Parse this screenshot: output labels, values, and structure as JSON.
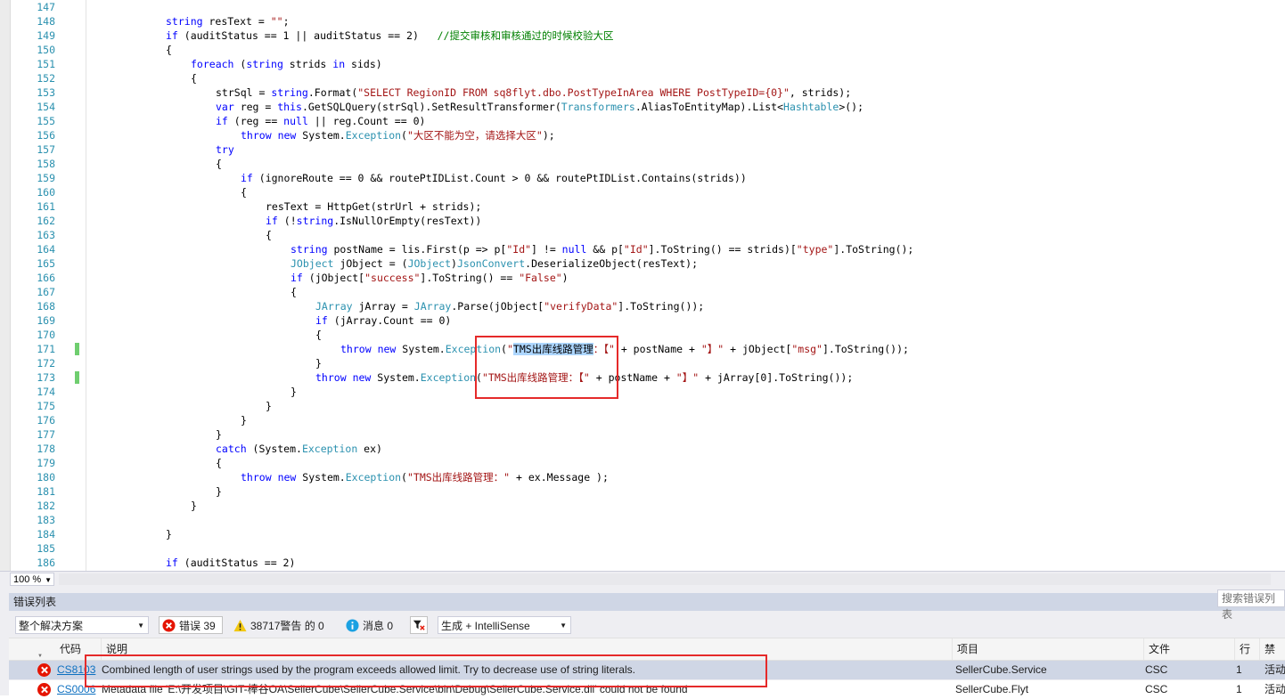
{
  "editor": {
    "lines": [
      {
        "num": "147",
        "indent": 0,
        "segs": []
      },
      {
        "num": "148",
        "indent": 2,
        "segs": [
          [
            "kw",
            "string"
          ],
          [
            "p",
            " resText = "
          ],
          [
            "str",
            "\"\""
          ],
          [
            "p",
            ";"
          ]
        ]
      },
      {
        "num": "149",
        "indent": 2,
        "segs": [
          [
            "kw",
            "if"
          ],
          [
            "p",
            " (auditStatus == 1 || auditStatus == 2)   "
          ],
          [
            "cm",
            "//提交审核和审核通过的时候校验大区"
          ]
        ]
      },
      {
        "num": "150",
        "indent": 2,
        "segs": [
          [
            "p",
            "{"
          ]
        ]
      },
      {
        "num": "151",
        "indent": 3,
        "segs": [
          [
            "kw",
            "foreach"
          ],
          [
            "p",
            " ("
          ],
          [
            "kw",
            "string"
          ],
          [
            "p",
            " strids "
          ],
          [
            "kw",
            "in"
          ],
          [
            "p",
            " sids)"
          ]
        ]
      },
      {
        "num": "152",
        "indent": 3,
        "segs": [
          [
            "p",
            "{"
          ]
        ]
      },
      {
        "num": "153",
        "indent": 4,
        "segs": [
          [
            "p",
            "strSql = "
          ],
          [
            "kw",
            "string"
          ],
          [
            "p",
            ".Format("
          ],
          [
            "str",
            "\"SELECT RegionID FROM sq8flyt.dbo.PostTypeInArea WHERE PostTypeID={0}\""
          ],
          [
            "p",
            ", strids);"
          ]
        ]
      },
      {
        "num": "154",
        "indent": 4,
        "segs": [
          [
            "kw",
            "var"
          ],
          [
            "p",
            " reg = "
          ],
          [
            "kw",
            "this"
          ],
          [
            "p",
            ".GetSQLQuery(strSql).SetResultTransformer("
          ],
          [
            "ty",
            "Transformers"
          ],
          [
            "p",
            ".AliasToEntityMap).List<"
          ],
          [
            "ty",
            "Hashtable"
          ],
          [
            "p",
            ">();"
          ]
        ]
      },
      {
        "num": "155",
        "indent": 4,
        "segs": [
          [
            "kw",
            "if"
          ],
          [
            "p",
            " (reg == "
          ],
          [
            "kw",
            "null"
          ],
          [
            "p",
            " || reg.Count == 0)"
          ]
        ]
      },
      {
        "num": "156",
        "indent": 5,
        "segs": [
          [
            "kw",
            "throw"
          ],
          [
            "p",
            " "
          ],
          [
            "kw",
            "new"
          ],
          [
            "p",
            " System."
          ],
          [
            "ty",
            "Exception"
          ],
          [
            "p",
            "("
          ],
          [
            "str",
            "\"大区不能为空，请选择大区\""
          ],
          [
            "p",
            ");"
          ]
        ]
      },
      {
        "num": "157",
        "indent": 4,
        "segs": [
          [
            "kw",
            "try"
          ]
        ]
      },
      {
        "num": "158",
        "indent": 4,
        "segs": [
          [
            "p",
            "{"
          ]
        ]
      },
      {
        "num": "159",
        "indent": 5,
        "segs": [
          [
            "kw",
            "if"
          ],
          [
            "p",
            " (ignoreRoute == 0 && routePtIDList.Count > 0 && routePtIDList.Contains(strids))"
          ]
        ]
      },
      {
        "num": "160",
        "indent": 5,
        "segs": [
          [
            "p",
            "{"
          ]
        ]
      },
      {
        "num": "161",
        "indent": 6,
        "segs": [
          [
            "p",
            "resText = HttpGet(strUrl + strids);"
          ]
        ]
      },
      {
        "num": "162",
        "indent": 6,
        "segs": [
          [
            "kw",
            "if"
          ],
          [
            "p",
            " (!"
          ],
          [
            "kw",
            "string"
          ],
          [
            "p",
            ".IsNullOrEmpty(resText))"
          ]
        ]
      },
      {
        "num": "163",
        "indent": 6,
        "segs": [
          [
            "p",
            "{"
          ]
        ]
      },
      {
        "num": "164",
        "indent": 7,
        "segs": [
          [
            "kw",
            "string"
          ],
          [
            "p",
            " postName = lis.First(p => p["
          ],
          [
            "str",
            "\"Id\""
          ],
          [
            "p",
            "] != "
          ],
          [
            "kw",
            "null"
          ],
          [
            "p",
            " && p["
          ],
          [
            "str",
            "\"Id\""
          ],
          [
            "p",
            "].ToString() == strids)["
          ],
          [
            "str",
            "\"type\""
          ],
          [
            "p",
            "].ToString();"
          ]
        ]
      },
      {
        "num": "165",
        "indent": 7,
        "segs": [
          [
            "ty",
            "JObject"
          ],
          [
            "p",
            " jObject = ("
          ],
          [
            "ty",
            "JObject"
          ],
          [
            "p",
            ")"
          ],
          [
            "ty",
            "JsonConvert"
          ],
          [
            "p",
            ".DeserializeObject(resText);"
          ]
        ]
      },
      {
        "num": "166",
        "indent": 7,
        "segs": [
          [
            "kw",
            "if"
          ],
          [
            "p",
            " (jObject["
          ],
          [
            "str",
            "\"success\""
          ],
          [
            "p",
            "].ToString() == "
          ],
          [
            "str",
            "\"False\""
          ],
          [
            "p",
            ")"
          ]
        ]
      },
      {
        "num": "167",
        "indent": 7,
        "segs": [
          [
            "p",
            "{"
          ]
        ]
      },
      {
        "num": "168",
        "indent": 8,
        "segs": [
          [
            "ty",
            "JArray"
          ],
          [
            "p",
            " jArray = "
          ],
          [
            "ty",
            "JArray"
          ],
          [
            "p",
            ".Parse(jObject["
          ],
          [
            "str",
            "\"verifyData\""
          ],
          [
            "p",
            "].ToString());"
          ]
        ]
      },
      {
        "num": "169",
        "indent": 8,
        "segs": [
          [
            "kw",
            "if"
          ],
          [
            "p",
            " (jArray.Count == 0)"
          ]
        ]
      },
      {
        "num": "170",
        "indent": 8,
        "segs": [
          [
            "p",
            "{"
          ]
        ]
      },
      {
        "num": "171",
        "indent": 9,
        "mark": true,
        "segs": [
          [
            "kw",
            "throw"
          ],
          [
            "p",
            " "
          ],
          [
            "kw",
            "new"
          ],
          [
            "p",
            " System."
          ],
          [
            "ty",
            "Exception"
          ],
          [
            "p",
            "("
          ],
          [
            "str",
            "\""
          ],
          [
            "sel",
            "TMS出库线路管理"
          ],
          [
            "str",
            "：【\""
          ],
          [
            "p",
            " + postName + "
          ],
          [
            "str",
            "\"】\""
          ],
          [
            "p",
            " + jObject["
          ],
          [
            "str",
            "\"msg\""
          ],
          [
            "p",
            "].ToString());"
          ]
        ]
      },
      {
        "num": "172",
        "indent": 8,
        "segs": [
          [
            "p",
            "}"
          ]
        ]
      },
      {
        "num": "173",
        "indent": 8,
        "mark": true,
        "segs": [
          [
            "kw",
            "throw"
          ],
          [
            "p",
            " "
          ],
          [
            "kw",
            "new"
          ],
          [
            "p",
            " System."
          ],
          [
            "ty",
            "Exception"
          ],
          [
            "p",
            "("
          ],
          [
            "str",
            "\"TMS出库线路管理：【\""
          ],
          [
            "p",
            " + postName + "
          ],
          [
            "str",
            "\"】\""
          ],
          [
            "p",
            " + jArray[0].ToString());"
          ]
        ]
      },
      {
        "num": "174",
        "indent": 7,
        "segs": [
          [
            "p",
            "}"
          ]
        ]
      },
      {
        "num": "175",
        "indent": 6,
        "segs": [
          [
            "p",
            "}"
          ]
        ]
      },
      {
        "num": "176",
        "indent": 5,
        "segs": [
          [
            "p",
            "}"
          ]
        ]
      },
      {
        "num": "177",
        "indent": 4,
        "segs": [
          [
            "p",
            "}"
          ]
        ]
      },
      {
        "num": "178",
        "indent": 4,
        "segs": [
          [
            "kw",
            "catch"
          ],
          [
            "p",
            " (System."
          ],
          [
            "ty",
            "Exception"
          ],
          [
            "p",
            " ex)"
          ]
        ]
      },
      {
        "num": "179",
        "indent": 4,
        "segs": [
          [
            "p",
            "{"
          ]
        ]
      },
      {
        "num": "180",
        "indent": 5,
        "segs": [
          [
            "kw",
            "throw"
          ],
          [
            "p",
            " "
          ],
          [
            "kw",
            "new"
          ],
          [
            "p",
            " System."
          ],
          [
            "ty",
            "Exception"
          ],
          [
            "p",
            "("
          ],
          [
            "str",
            "\"TMS出库线路管理：\""
          ],
          [
            "p",
            " + ex.Message );"
          ]
        ]
      },
      {
        "num": "181",
        "indent": 4,
        "segs": [
          [
            "p",
            "}"
          ]
        ]
      },
      {
        "num": "182",
        "indent": 3,
        "segs": [
          [
            "p",
            "}"
          ]
        ]
      },
      {
        "num": "183",
        "indent": 0,
        "segs": []
      },
      {
        "num": "184",
        "indent": 2,
        "segs": [
          [
            "p",
            "}"
          ]
        ]
      },
      {
        "num": "185",
        "indent": 0,
        "segs": []
      },
      {
        "num": "186",
        "indent": 2,
        "segs": [
          [
            "kw",
            "if"
          ],
          [
            "p",
            " (auditStatus == 2)"
          ]
        ]
      }
    ]
  },
  "zoom": {
    "value": "100 %"
  },
  "error_list": {
    "title": "错误列表",
    "scope": "整个解决方案",
    "errors_label": "错误 39",
    "warnings_label": "38717警告 的 0",
    "messages_label": "消息 0",
    "build_filter": "生成 + IntelliSense",
    "search_placeholder": "搜索错误列表",
    "columns": {
      "code": "代码",
      "description": "说明",
      "project": "项目",
      "file": "文件",
      "line": "行",
      "suppression": "禁止"
    },
    "rows": [
      {
        "code": "CS8103",
        "description": "Combined length of user strings used by the program exceeds allowed limit. Try to decrease use of string literals.",
        "project": "SellerCube.Service",
        "file": "CSC",
        "line": "1",
        "state": "活动"
      },
      {
        "code": "CS0006",
        "description": "Metadata file 'E:\\开发项目\\GIT-棒谷OA\\SellerCube\\SellerCube.Service\\bin\\Debug\\SellerCube.Service.dll' could not be found",
        "project": "SellerCube.Flyt",
        "file": "CSC",
        "line": "1",
        "state": "活动"
      }
    ]
  },
  "colors": {
    "keyword": "#0000ff",
    "type": "#2b91af",
    "string": "#a31515",
    "comment": "#008000",
    "error": "#e51400",
    "highlight_box": "#e52a2a"
  }
}
